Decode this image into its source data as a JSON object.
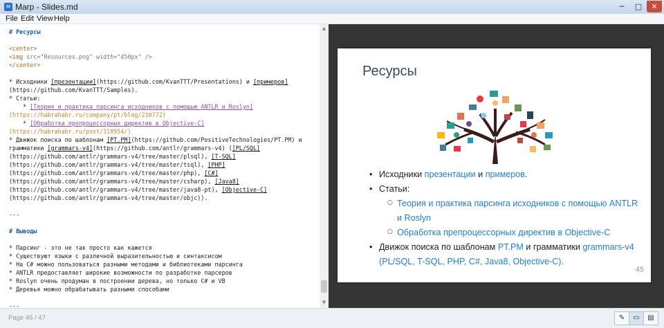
{
  "window": {
    "icon_text": "M",
    "title": "Marp - Slides.md",
    "controls": {
      "minimize": "─",
      "maximize": "□",
      "close": "✕"
    }
  },
  "menu": [
    "File",
    "Edit",
    "View",
    "Help"
  ],
  "editor": {
    "lines": [
      {
        "parts": [
          {
            "c": "h",
            "t": "# Ресурсы"
          }
        ]
      },
      {
        "parts": []
      },
      {
        "parts": [
          {
            "c": "tag",
            "t": "<center>"
          }
        ]
      },
      {
        "parts": [
          {
            "c": "tag",
            "t": "<img "
          },
          {
            "c": "attr",
            "t": "src=\"Resources.png\" width=\"450px\""
          },
          {
            "c": "tag",
            "t": " />"
          }
        ]
      },
      {
        "parts": [
          {
            "c": "tag",
            "t": "</center>"
          }
        ]
      },
      {
        "parts": []
      },
      {
        "parts": [
          {
            "c": "",
            "t": "* Исходники "
          },
          {
            "c": "lnk",
            "t": "[презентации]"
          },
          {
            "c": "",
            "t": "(https://github.com/KvanTTT/Presentations) и "
          },
          {
            "c": "lnk",
            "t": "[примеров]"
          }
        ]
      },
      {
        "parts": [
          {
            "c": "",
            "t": "(https://github.com/KvanTTT/Samples)."
          }
        ]
      },
      {
        "parts": [
          {
            "c": "",
            "t": "* Статьи:"
          }
        ]
      },
      {
        "parts": [
          {
            "c": "",
            "t": "    * "
          },
          {
            "c": "plk",
            "t": "[Теория и практика парсинга исходников с помощью ANTLR и Roslyn]"
          }
        ]
      },
      {
        "parts": [
          {
            "c": "url",
            "t": "(https://habrahabr.ru/company/pt/blog/210772)"
          }
        ]
      },
      {
        "parts": [
          {
            "c": "",
            "t": "    * "
          },
          {
            "c": "plk",
            "t": "[Обработка препроцессорных директив в Objective-C]"
          }
        ]
      },
      {
        "parts": [
          {
            "c": "url",
            "t": "(https://habrahabr.ru/post/318954/)"
          }
        ]
      },
      {
        "parts": [
          {
            "c": "",
            "t": "* Движок поиска по шаблонам "
          },
          {
            "c": "lnk",
            "t": "[PT.PM]"
          },
          {
            "c": "",
            "t": "(https://github.com/PositiveTechnologies/PT.PM) и"
          }
        ]
      },
      {
        "parts": [
          {
            "c": "",
            "t": "грамматики "
          },
          {
            "c": "lnk",
            "t": "[grammars-v4]"
          },
          {
            "c": "",
            "t": "(https://github.com/antlr/grammars-v4) ("
          },
          {
            "c": "lnk",
            "t": "[PL/SQL]"
          }
        ]
      },
      {
        "parts": [
          {
            "c": "",
            "t": "(https://github.com/antlr/grammars-v4/tree/master/plsql), "
          },
          {
            "c": "lnk",
            "t": "[T-SQL]"
          }
        ]
      },
      {
        "parts": [
          {
            "c": "",
            "t": "(https://github.com/antlr/grammars-v4/tree/master/tsql), "
          },
          {
            "c": "lnk",
            "t": "[PHP]"
          }
        ]
      },
      {
        "parts": [
          {
            "c": "",
            "t": "(https://github.com/antlr/grammars-v4/tree/master/php), "
          },
          {
            "c": "lnk",
            "t": "[C#]"
          }
        ]
      },
      {
        "parts": [
          {
            "c": "",
            "t": "(https://github.com/antlr/grammars-v4/tree/master/csharp), "
          },
          {
            "c": "lnk",
            "t": "[Java8]"
          }
        ]
      },
      {
        "parts": [
          {
            "c": "",
            "t": "(https://github.com/antlr/grammars-v4/tree/master/java8-pt), "
          },
          {
            "c": "lnk",
            "t": "[Objective-C]"
          }
        ]
      },
      {
        "parts": [
          {
            "c": "",
            "t": "(https://github.com/antlr/grammars-v4/tree/master/objc))."
          }
        ]
      },
      {
        "parts": []
      },
      {
        "parts": [
          {
            "c": "",
            "t": "---"
          }
        ]
      },
      {
        "parts": []
      },
      {
        "parts": [
          {
            "c": "h",
            "t": "# Выводы"
          }
        ]
      },
      {
        "parts": []
      },
      {
        "parts": [
          {
            "c": "",
            "t": "* Парсинг - это не так просто как кажется"
          }
        ]
      },
      {
        "parts": [
          {
            "c": "",
            "t": "* Существуют языки с различной выразительностью и синтаксисом"
          }
        ]
      },
      {
        "parts": [
          {
            "c": "",
            "t": "* На C# можно пользоваться разными методами и библиотеками парсинга"
          }
        ]
      },
      {
        "parts": [
          {
            "c": "",
            "t": "* ANTLR предоставляет широкие возможности по разработке парсеров"
          }
        ]
      },
      {
        "parts": [
          {
            "c": "",
            "t": "* Roslyn очень продуман в построении дерева, но только C# и VB"
          }
        ]
      },
      {
        "parts": [
          {
            "c": "",
            "t": "* Деревья можно обрабатывать разными способами"
          }
        ]
      },
      {
        "parts": []
      },
      {
        "parts": [
          {
            "c": "",
            "t": "---"
          }
        ]
      }
    ]
  },
  "preview": {
    "title": "Ресурсы",
    "image_icon": "resources-tree-illustration",
    "bullets": {
      "b1_prefix": "Исходники ",
      "b1_link1": "презентации",
      "b1_mid": " и ",
      "b1_link2": "примеров",
      "b1_suffix": ".",
      "b2": "Статьи:",
      "sub1": "Теория и практика парсинга исходников с помощью ANTLR и Roslyn",
      "sub2": "Обработка препроцессорных директив в Objective-C",
      "b3_prefix": "Движок поиска по шаблонам ",
      "b3_link1": "PT.PM",
      "b3_mid": " и грамматики ",
      "b3_link2": "grammars-v4",
      "b3_paren_open": " (",
      "b3_l1": "PL/SQL",
      "b3_l2": "T-SQL",
      "b3_l3": "PHP",
      "b3_l4": "C#",
      "b3_l5": "Java8",
      "b3_l6": "Objective-C",
      "comma": ", ",
      "b3_end": ")."
    },
    "page_number": "45"
  },
  "status": {
    "page": "Page 45 / 47",
    "buttons": [
      "pencil-icon",
      "monitor-icon",
      "trash-icon"
    ]
  },
  "colors": {
    "link": "#1f7ed4",
    "heading": "#1a5fa8",
    "preview_bg": "#353535"
  }
}
